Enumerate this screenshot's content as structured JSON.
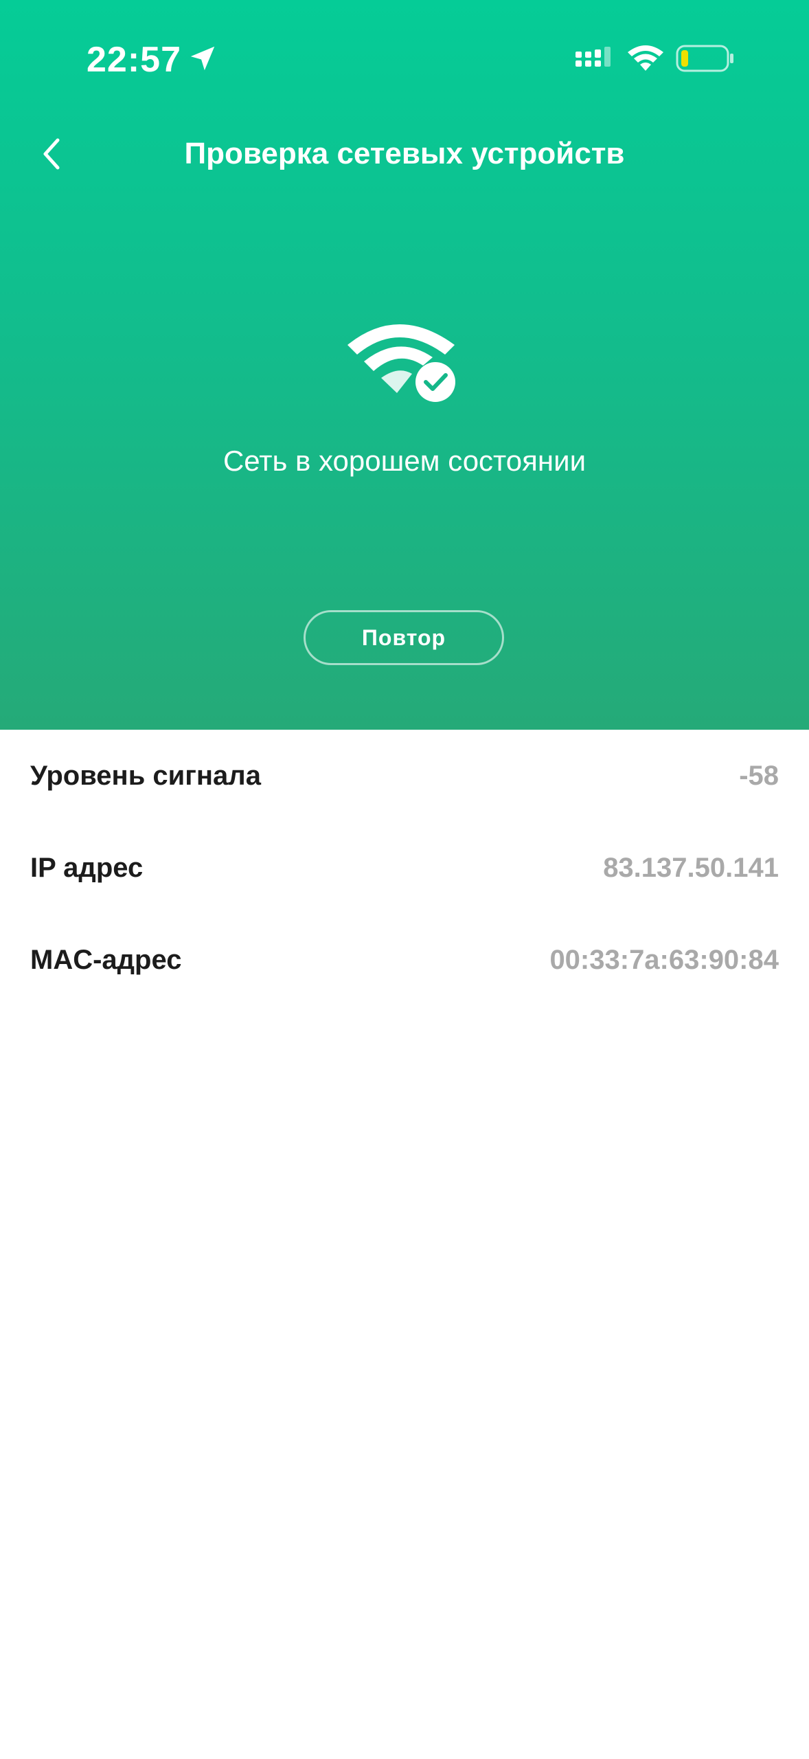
{
  "status_bar": {
    "time": "22:57",
    "icons": [
      "location-arrow-icon",
      "cellular-signal-icon",
      "wifi-icon",
      "battery-low-icon"
    ],
    "battery_color": "#f0e000"
  },
  "header": {
    "title": "Проверка сетевых устройств",
    "back_icon": "chevron-left-icon"
  },
  "network_status": {
    "icon": "wifi-check-icon",
    "text": "Сеть в хорошем состоянии",
    "retry_label": "Повтор"
  },
  "details": [
    {
      "label": "Уровень сигнала",
      "value": "-58"
    },
    {
      "label": "IP адрес",
      "value": "83.137.50.141"
    },
    {
      "label": "MAC-адрес",
      "value": "00:33:7a:63:90:84"
    }
  ],
  "colors": {
    "accent_top": "#05cc97",
    "accent_bottom": "#25aa78",
    "label_text": "#1c1c1c",
    "value_text": "#a9a9a9"
  }
}
